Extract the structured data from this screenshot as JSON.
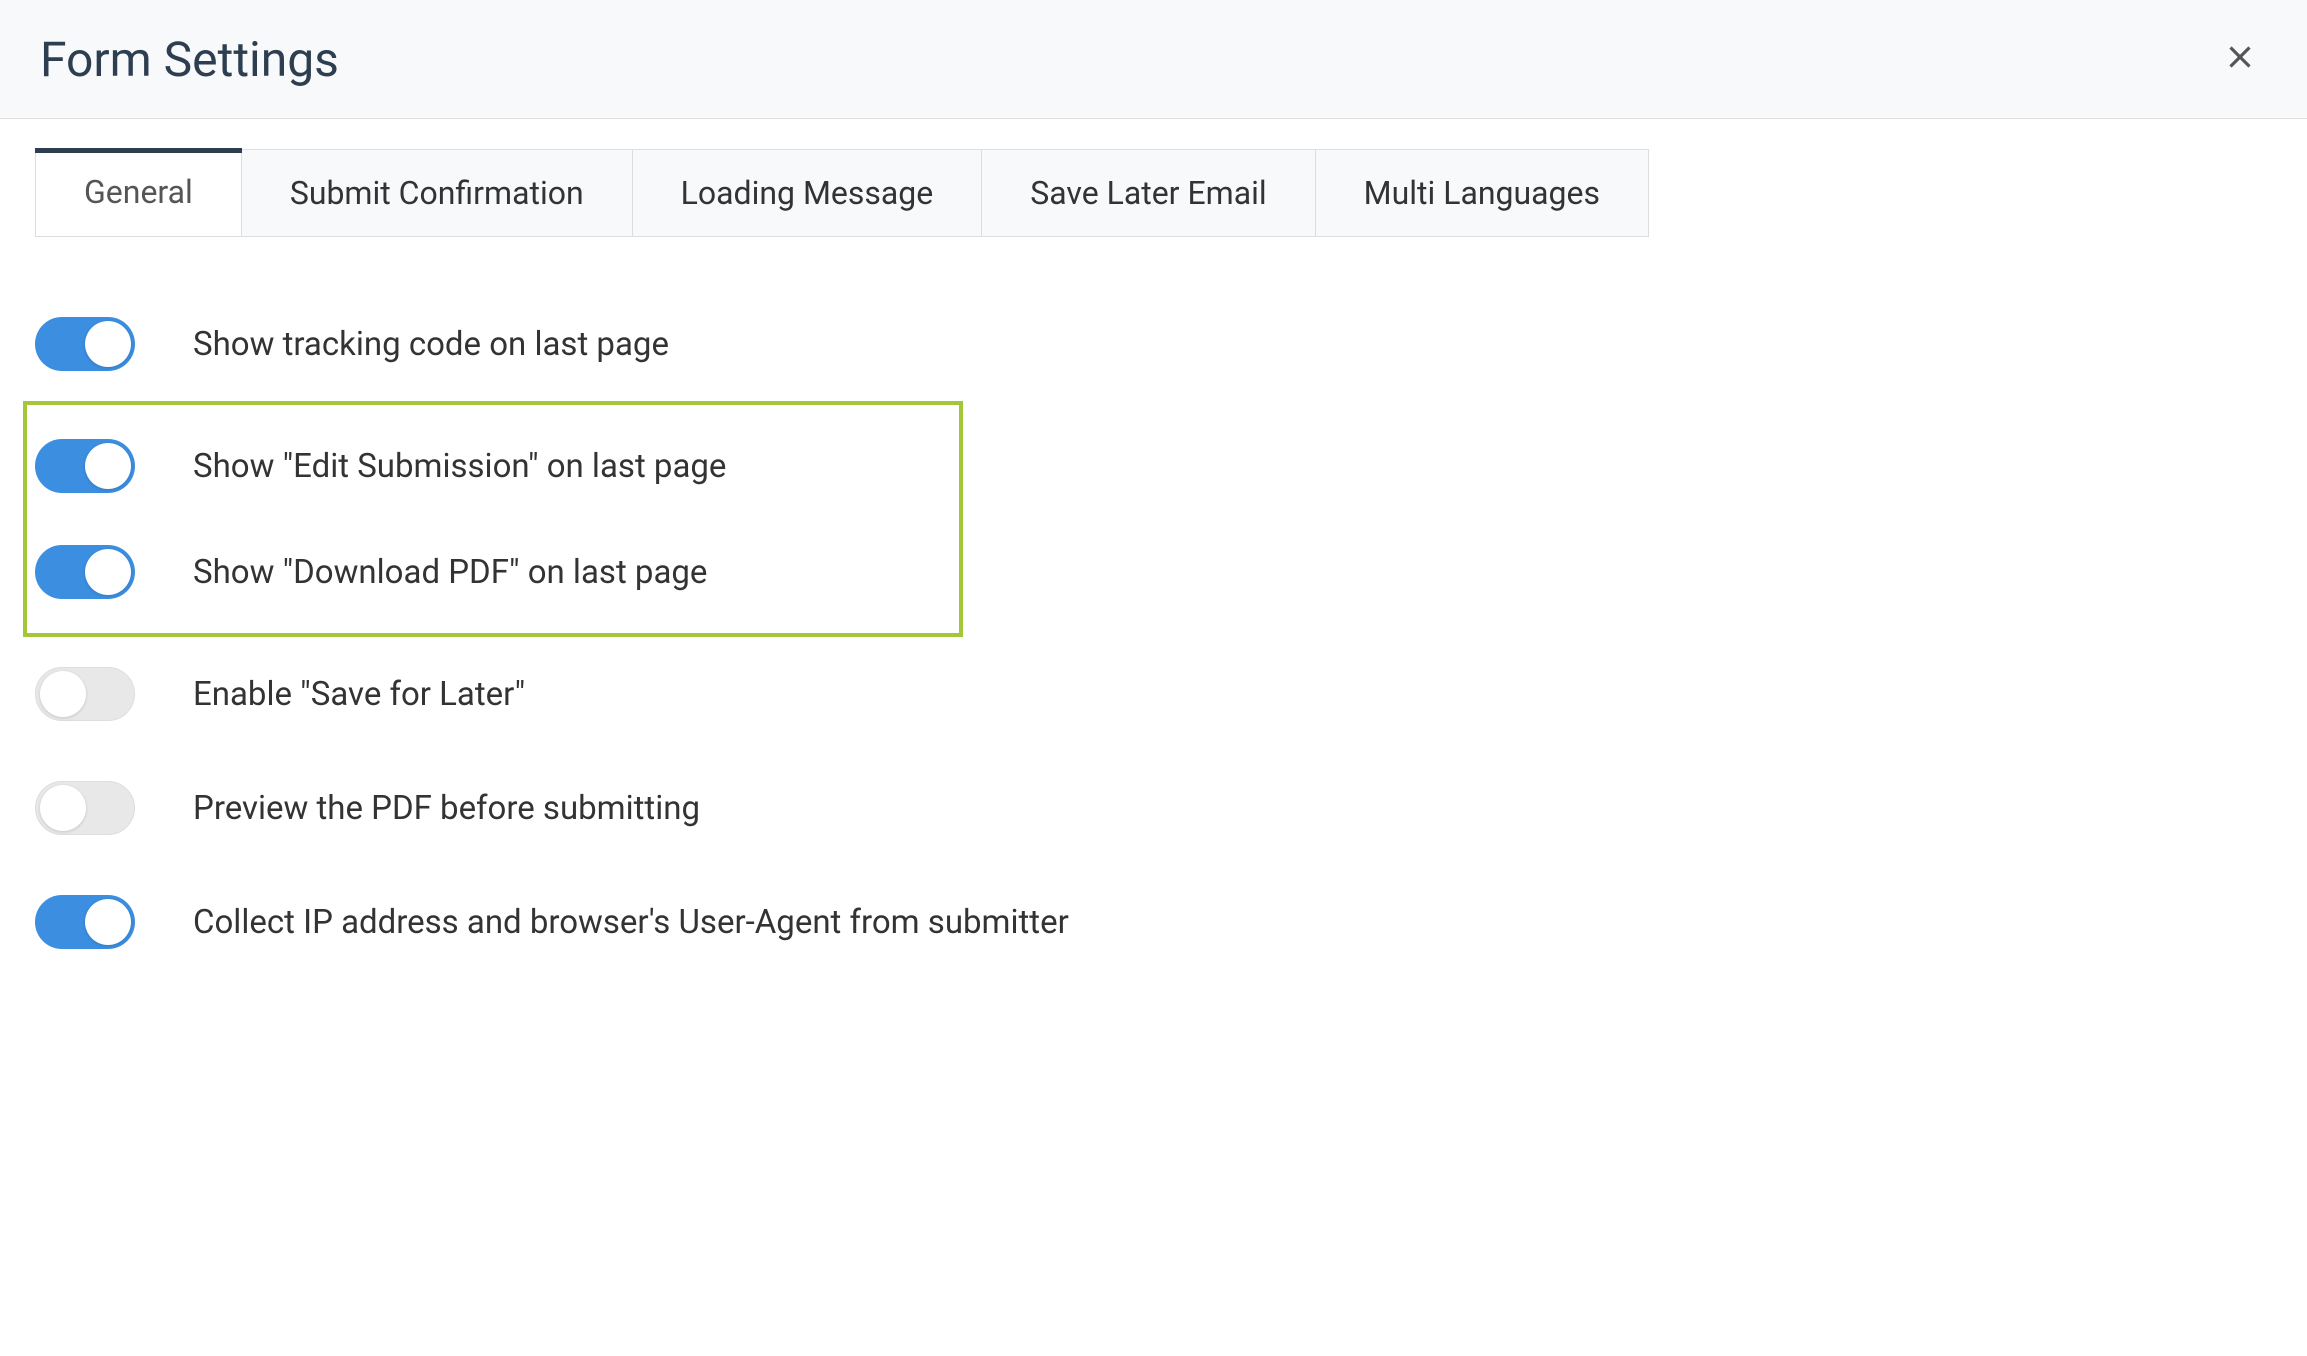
{
  "header": {
    "title": "Form Settings"
  },
  "tabs": [
    {
      "label": "General",
      "active": true
    },
    {
      "label": "Submit Confirmation",
      "active": false
    },
    {
      "label": "Loading Message",
      "active": false
    },
    {
      "label": "Save Later Email",
      "active": false
    },
    {
      "label": "Multi Languages",
      "active": false
    }
  ],
  "settings": [
    {
      "label": "Show tracking code on last page",
      "enabled": true,
      "highlighted": false
    },
    {
      "label": "Show \"Edit Submission\" on last page",
      "enabled": true,
      "highlighted": true
    },
    {
      "label": "Show \"Download PDF\" on last page",
      "enabled": true,
      "highlighted": true
    },
    {
      "label": "Enable \"Save for Later\"",
      "enabled": false,
      "highlighted": false
    },
    {
      "label": "Preview the PDF before submitting",
      "enabled": false,
      "highlighted": false
    },
    {
      "label": "Collect IP address and browser's User-Agent from submitter",
      "enabled": true,
      "highlighted": false
    }
  ]
}
